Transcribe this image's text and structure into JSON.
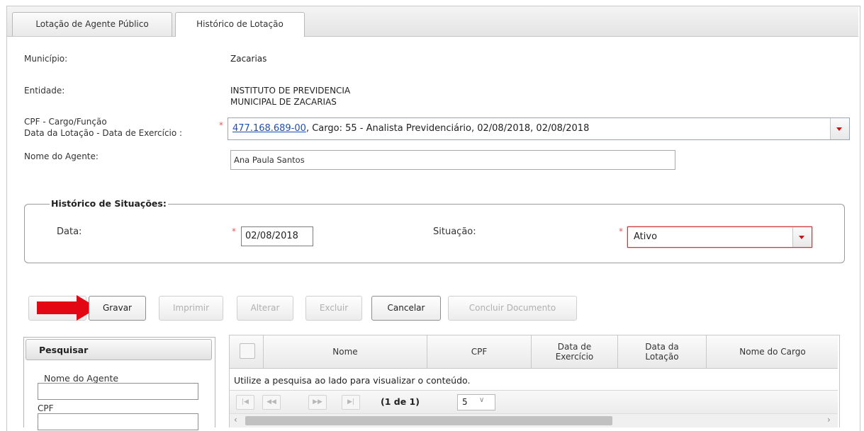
{
  "tabs": [
    {
      "label": "Lotação de Agente Público"
    },
    {
      "label": "Histórico de Lotação"
    }
  ],
  "form": {
    "municipio_label": "Município:",
    "municipio_value": "Zacarias",
    "entidade_label": "Entidade:",
    "entidade_value_1": "INSTITUTO DE PREVIDENCIA",
    "entidade_value_2": "MUNICIPAL DE ZACARIAS",
    "cpf_label_1": "CPF - Cargo/Função",
    "cpf_label_2": "Data da Lotação - Data de Exercício :",
    "cpf_link": "477.168.689-00",
    "cpf_rest": ", Cargo: 55 - Analista Previdenciário, 02/08/2018, 02/08/2018",
    "nome_label": "Nome do Agente:",
    "nome_value": "Ana Paula Santos",
    "required_mark": "*"
  },
  "historico": {
    "legend": "Histórico de Situações:",
    "data_label": "Data:",
    "data_value": "02/08/2018",
    "situacao_label": "Situação:",
    "situacao_value": "Ativo"
  },
  "buttons": {
    "gravar": "Gravar",
    "imprimir": "Imprimir",
    "alterar": "Alterar",
    "excluir": "Excluir",
    "cancelar": "Cancelar",
    "concluir": "Concluir Documento"
  },
  "search": {
    "title": "Pesquisar",
    "nome_label": "Nome do Agente",
    "cpf_label": "CPF"
  },
  "grid": {
    "columns": [
      {
        "line1": "Nome",
        "line2": ""
      },
      {
        "line1": "CPF",
        "line2": ""
      },
      {
        "line1": "Data de",
        "line2": "Exercício"
      },
      {
        "line1": "Data da",
        "line2": "Lotação"
      },
      {
        "line1": "Nome do Cargo",
        "line2": ""
      }
    ],
    "empty_message": "Utilize a pesquisa ao lado para visualizar o conteúdo.",
    "page_info": "(1 de 1)",
    "page_size": "5"
  },
  "colors": {
    "accent_red": "#cc1111",
    "link": "#1a4fb5"
  }
}
